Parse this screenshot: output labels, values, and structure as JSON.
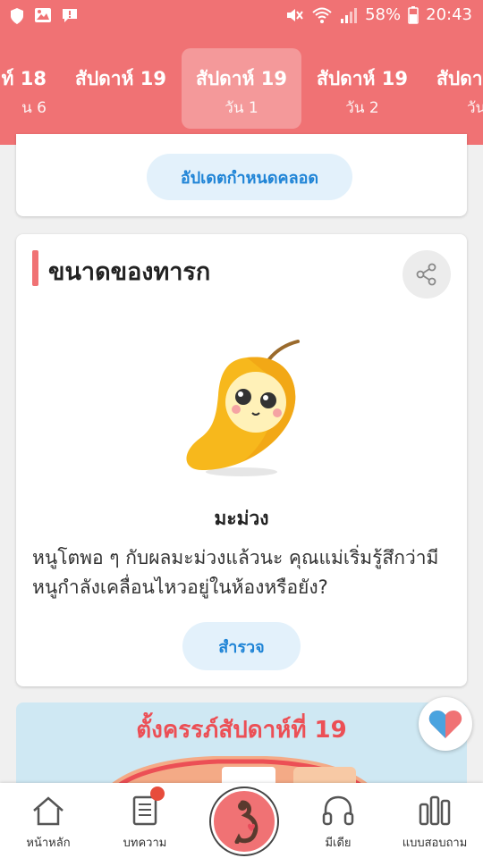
{
  "status_bar": {
    "battery": "58%",
    "time": "20:43"
  },
  "week_tabs": [
    {
      "title": "ท์ 18",
      "day": "น 6"
    },
    {
      "title": "สัปดาห์ 19",
      "day": ""
    },
    {
      "title": "สัปดาห์ 19",
      "day": "วัน 1"
    },
    {
      "title": "สัปดาห์ 19",
      "day": "วัน 2"
    },
    {
      "title": "สัปดา",
      "day": "วัน"
    }
  ],
  "due_date_card": {
    "button_label": "อัปเดตกำหนดคลอด"
  },
  "baby_size": {
    "title": "ขนาดของทารก",
    "fruit_name": "มะม่วง",
    "description": "หนูโตพอ ๆ กับผลมะม่วงแล้วนะ คุณแม่เริ่มรู้สึกว่ามีหนูกำลังเคลื่อนไหวอยู่ในห้องหรือยัง?",
    "button_label": "สำรวจ"
  },
  "promo": {
    "title": "ตั้งครรภ์สัปดาห์ที่ 19"
  },
  "bottom_nav": {
    "home": "หน้าหลัก",
    "articles": "บทความ",
    "media": "มีเดีย",
    "quiz": "แบบสอบถาม"
  },
  "colors": {
    "brand": "#f07274",
    "accent_blue": "#1f84d6",
    "pill_bg": "#e3f1fb"
  }
}
